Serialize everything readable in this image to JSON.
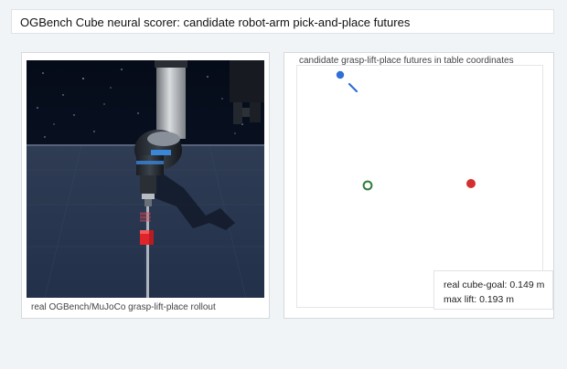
{
  "header": {
    "title": "OGBench Cube neural scorer: candidate robot-arm pick-and-place futures"
  },
  "rollout_panel": {
    "caption": "real OGBench/MuJoCo grasp-lift-place rollout"
  },
  "plot_panel": {
    "title": "candidate grasp-lift-place futures in table coordinates"
  },
  "stats": {
    "cube_goal_label": "real cube-goal: 0.149 m",
    "max_lift_label": "max lift: 0.193 m"
  },
  "markers": {
    "start": {
      "color": "#2f6fd6"
    },
    "current": {
      "color": "#2e7d3a"
    },
    "goal": {
      "color": "#d32f2f"
    }
  },
  "colors": {
    "page_bg": "#f1f4f6",
    "scene_bg": "#0b1626",
    "cube": "#e0242a"
  }
}
